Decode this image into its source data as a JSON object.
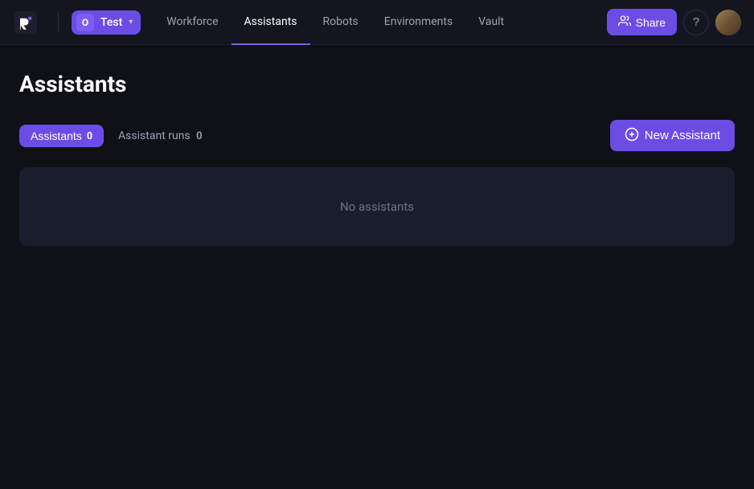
{
  "app": {
    "logo_label": "Robocorp logo"
  },
  "navbar": {
    "workspace_initial": "O",
    "workspace_name": "Test",
    "chevron": "▾",
    "links": [
      {
        "id": "workforce",
        "label": "Workforce",
        "active": false
      },
      {
        "id": "assistants",
        "label": "Assistants",
        "active": true
      },
      {
        "id": "robots",
        "label": "Robots",
        "active": false
      },
      {
        "id": "environments",
        "label": "Environments",
        "active": false
      },
      {
        "id": "vault",
        "label": "Vault",
        "active": false
      }
    ],
    "share_label": "Share",
    "share_icon": "👥",
    "help_icon": "?",
    "avatar_label": "User avatar"
  },
  "page": {
    "title": "Assistants"
  },
  "tabs": {
    "assistants_label": "Assistants",
    "assistants_count": "0",
    "runs_label": "Assistant runs",
    "runs_count": "0"
  },
  "new_assistant": {
    "label": "New Assistant",
    "icon": "⊕"
  },
  "empty_state": {
    "message": "No assistants"
  }
}
